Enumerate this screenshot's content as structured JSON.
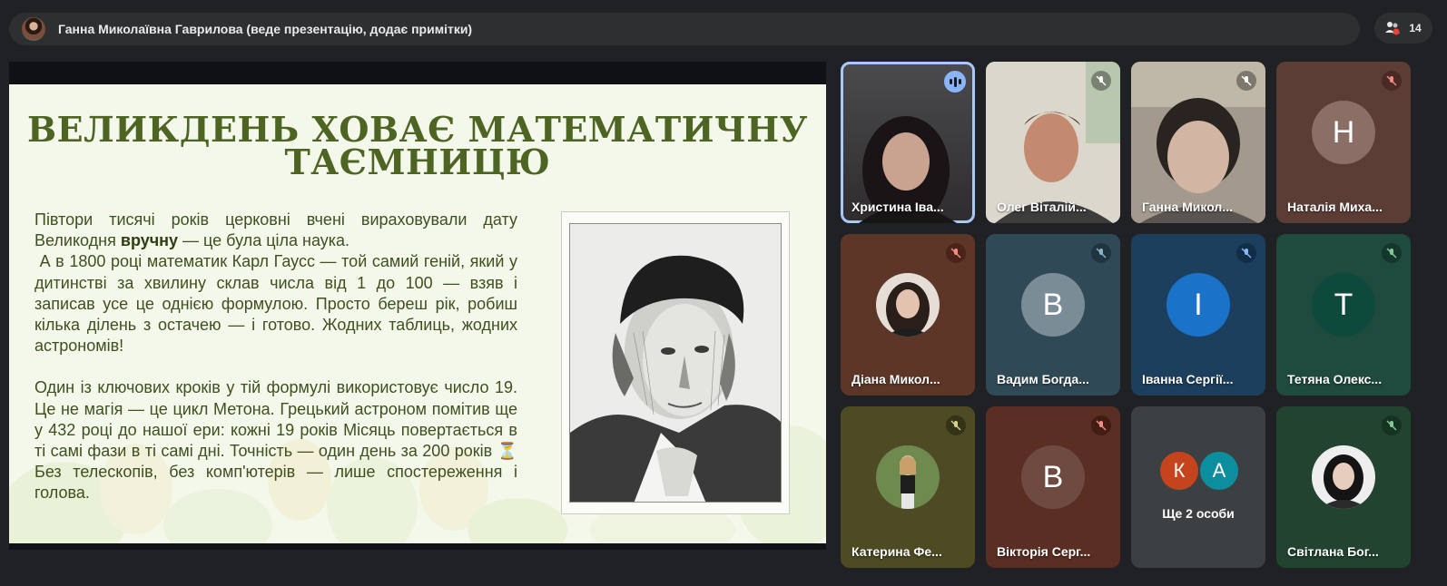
{
  "presenter": {
    "text": "Ганна Миколаївна Гаврилова (веде презентацію, додає примітки)"
  },
  "people": {
    "count": "14",
    "icon": "people-icon"
  },
  "slide": {
    "title_line1": "ВЕЛИКДЕНЬ ХОВАЄ МАТЕМАТИЧНУ",
    "title_line2": "ТАЄМНИЦЮ",
    "p1_before": "Півтори тисячі років церковні вчені вираховували дату Великодня ",
    "p1_bold": "вручну",
    "p1_after": " — це була ціла наука.",
    "p2": "А в 1800 році математик Карл Гаусс — той самий геній, який у дитинстві за хвилину склав числа від 1 до 100 — взяв і записав усе це однією формулою. Просто береш рік, робиш кілька ділень з остачею — і готово. Жодних таблиць, жодних астрономів!",
    "p3_before": "Один із ключових кроків у тій формулі використовує число 19. Це не магія — це цикл Метона. Грецький астроном помітив ще у 432 році до нашої ери: кожні 19 років Місяць повертається в ті самі фази в ті самі дні. Точність — один день за 200 років ",
    "p3_emoji": "⏳",
    "p3_after": " Без телескопів, без комп'ютерів — лише спостереження і голова."
  },
  "tiles": [
    {
      "name": "Христина Іва...",
      "state": "speaking"
    },
    {
      "name": "Олег Віталій...",
      "state": "muted"
    },
    {
      "name": "Ганна Микол...",
      "state": "muted"
    },
    {
      "name": "Наталія Миха...",
      "letter": "Н",
      "state": "muted"
    },
    {
      "name": "Діана Микол...",
      "state": "muted"
    },
    {
      "name": "Вадим Богда...",
      "letter": "В",
      "state": "muted"
    },
    {
      "name": "Іванна Сергії...",
      "letter": "І",
      "state": "muted"
    },
    {
      "name": "Тетяна Олекс...",
      "letter": "Т",
      "state": "muted"
    },
    {
      "name": "Катерина Фе...",
      "state": "muted"
    },
    {
      "name": "Вікторія Серг...",
      "letter": "В",
      "state": "muted"
    },
    {
      "more_label": "Ще 2 особи",
      "avatars": [
        "К",
        "А"
      ]
    },
    {
      "name": "Світлана Бог...",
      "state": "muted"
    }
  ],
  "colors": {
    "accent_speaking": "#a8c7fa",
    "slide_title": "#4d6423",
    "slide_text": "#3f4f1f",
    "slide_bg": "#f3f8ea"
  }
}
